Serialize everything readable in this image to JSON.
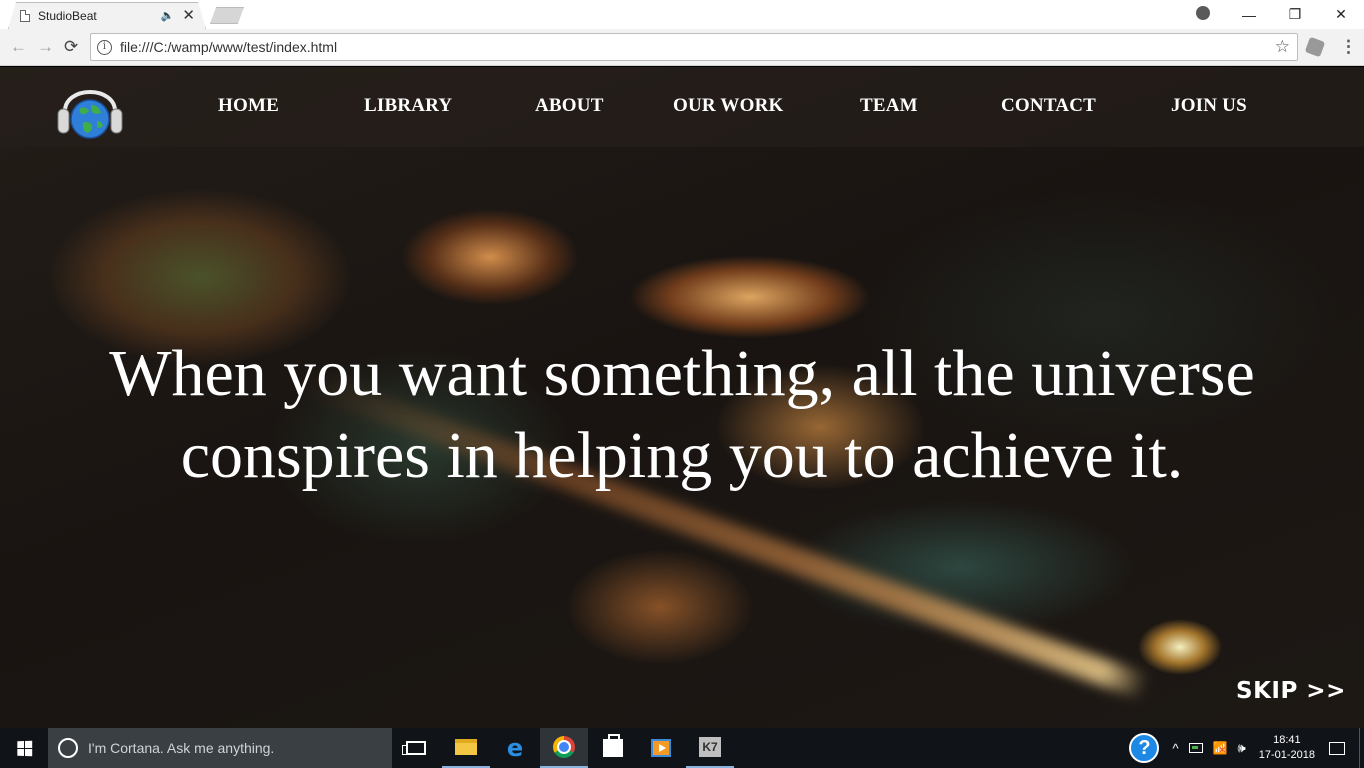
{
  "browser": {
    "tab_title": "StudioBeat",
    "tab_audio_icon": "speaker-icon",
    "tab_close_glyph": "✕",
    "window_minimize_glyph": "—",
    "window_restore_glyph": "❐",
    "window_close_glyph": "✕",
    "back_glyph": "←",
    "forward_glyph": "→",
    "reload_glyph": "⟳",
    "info_glyph": "i",
    "url": "file:///C:/wamp/www/test/index.html",
    "star_glyph": "☆",
    "menu_glyph": "⋮"
  },
  "site": {
    "logo_icon": "globe-headphones-logo",
    "nav": [
      {
        "label": "HOME"
      },
      {
        "label": "LIBRARY"
      },
      {
        "label": "ABOUT"
      },
      {
        "label": "OUR WORK"
      },
      {
        "label": "TEAM"
      },
      {
        "label": "CONTACT"
      },
      {
        "label": "JOIN US"
      }
    ],
    "headline_line1": "When you want something, all the universe",
    "headline_line2": "conspires in helping you to achieve it.",
    "skip_label": "SKIP >>",
    "colors": {
      "nav_text": "#ffffff",
      "headline_text": "#ffffff",
      "navbar_bg": "rgba(40,33,29,0.55)"
    }
  },
  "taskbar": {
    "cortana_placeholder": "I'm Cortana. Ask me anything.",
    "apps": [
      "task-view",
      "file-explorer",
      "edge",
      "chrome",
      "store",
      "video-editor",
      "k7-antivirus"
    ],
    "help_glyph": "?",
    "chevron_glyph": "^",
    "volume_glyph": "🕪",
    "net_glyph": "✕",
    "time": "18:41",
    "date": "17-01-2018"
  }
}
